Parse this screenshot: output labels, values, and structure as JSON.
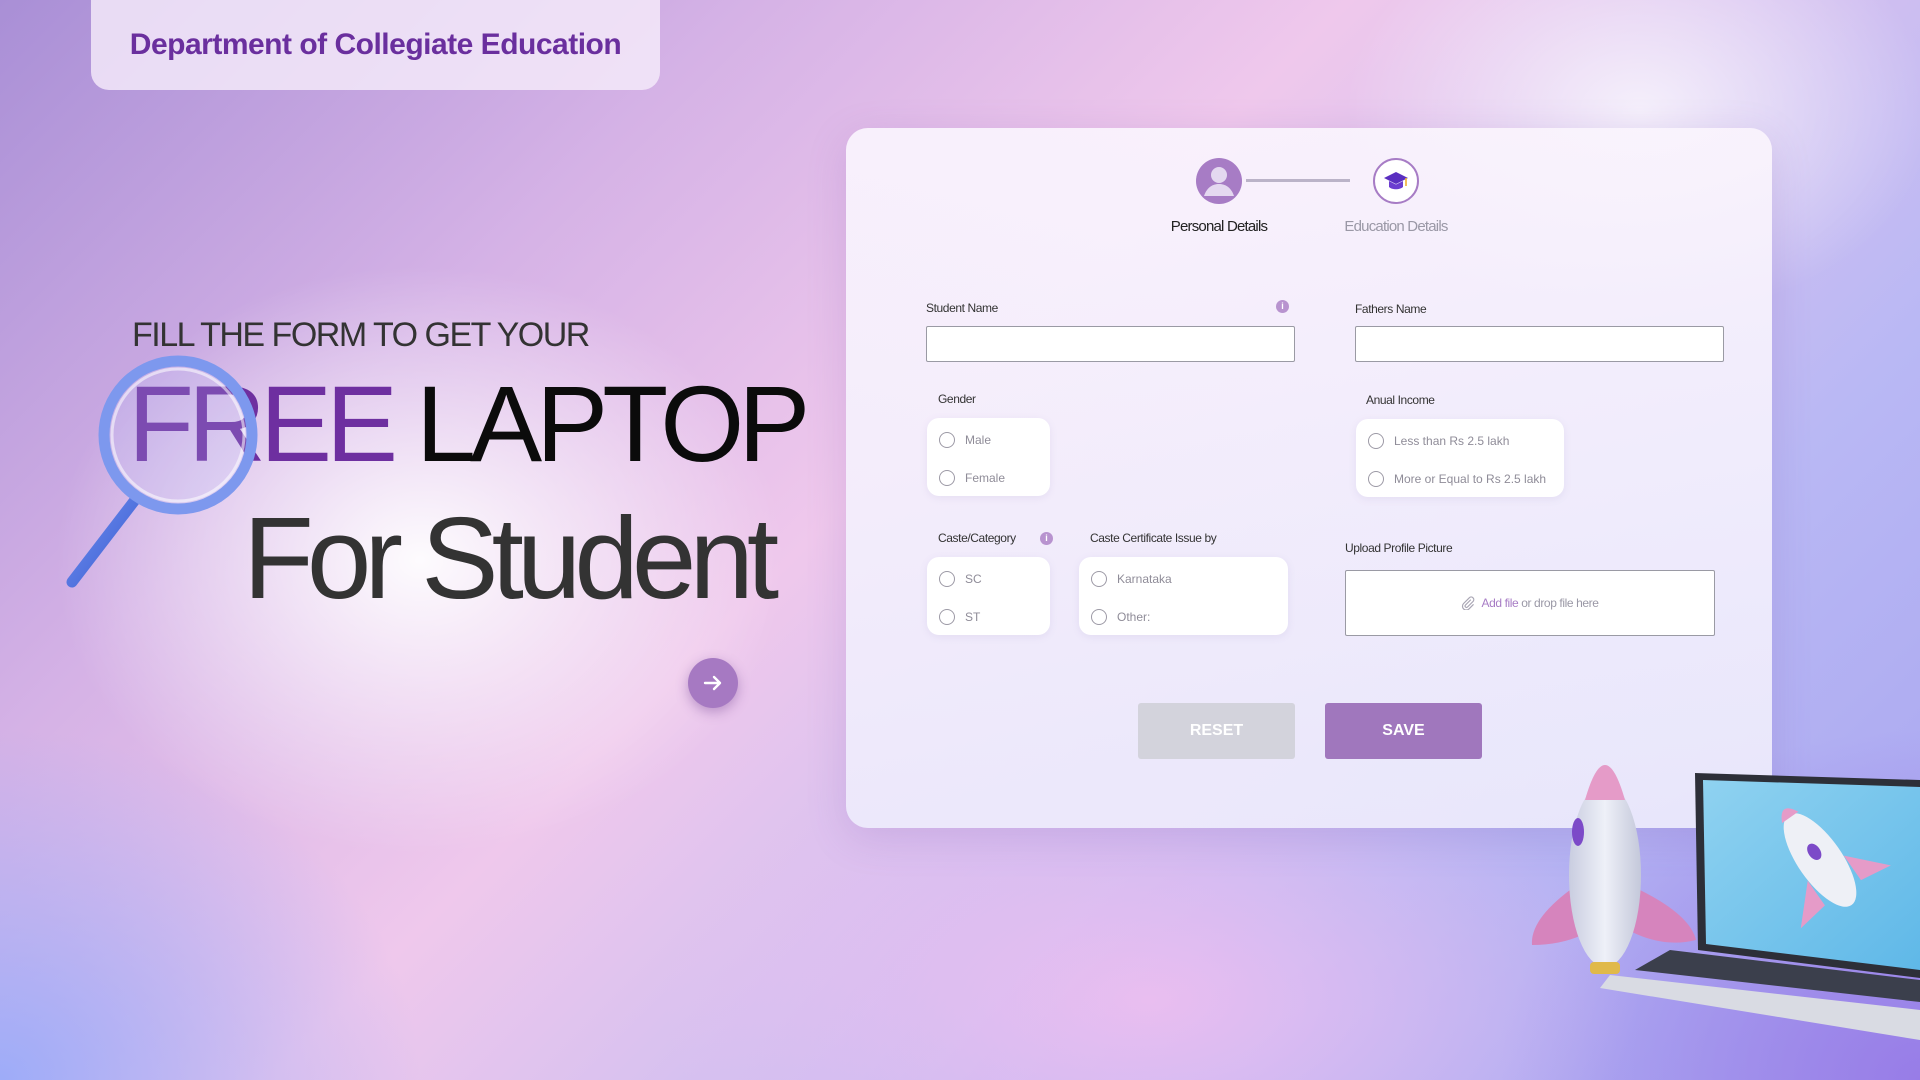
{
  "header": {
    "title": "Department of Collegiate Education"
  },
  "hero": {
    "line1": "FILL THE FORM TO GET YOUR",
    "free": "FREE",
    "laptop": " LAPTOP",
    "line3": "For Student"
  },
  "stepper": {
    "steps": [
      {
        "label": "Personal Details",
        "icon": "user-icon",
        "state": "active"
      },
      {
        "label": "Education Details",
        "icon": "graduation-cap-icon",
        "state": "inactive"
      }
    ]
  },
  "form": {
    "student_name": {
      "label": "Student Name",
      "value": ""
    },
    "fathers_name": {
      "label": "Fathers Name",
      "value": ""
    },
    "gender": {
      "label": "Gender",
      "options": [
        "Male",
        "Female"
      ]
    },
    "annual_income": {
      "label": "Anual Income",
      "options": [
        "Less than Rs 2.5 lakh",
        "More or Equal to Rs 2.5 lakh"
      ]
    },
    "caste_category": {
      "label": "Caste/Category",
      "options": [
        "SC",
        "ST"
      ]
    },
    "caste_certificate": {
      "label": "Caste Certificate Issue by",
      "options": [
        "Karnataka",
        "Other:"
      ]
    },
    "upload": {
      "label": "Upload Profile Picture",
      "link_text": "Add file",
      "rest_text": " or drop file here"
    },
    "info_glyph": "i"
  },
  "buttons": {
    "reset": "RESET",
    "save": "SAVE"
  },
  "colors": {
    "accent": "#a077bd",
    "brand": "#6e2fa0",
    "reset_bg": "#d3d3dc"
  }
}
